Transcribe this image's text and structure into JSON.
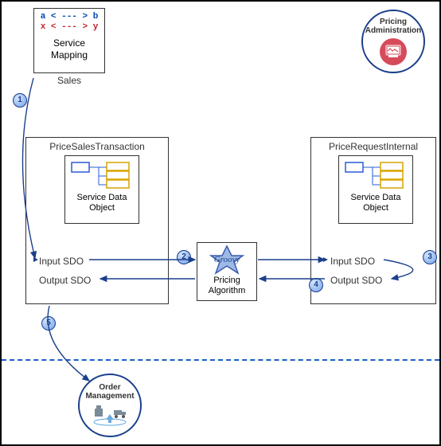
{
  "serviceMapping": {
    "code1": "a < --- > b",
    "code2": "x < --- > y",
    "label": "Service Mapping",
    "outer": "Sales"
  },
  "pst": {
    "title": "PriceSalesTransaction",
    "sdo": "Service Data Object",
    "input": "Input SDO",
    "output": "Output SDO"
  },
  "pri": {
    "title": "PriceRequestInternal",
    "sdo": "Service Data Object",
    "input": "Input SDO",
    "output": "Output SDO"
  },
  "algo": {
    "label": "Pricing Algorithm"
  },
  "pa": {
    "label": "Pricing Administration"
  },
  "om": {
    "label": "Order Management"
  },
  "steps": {
    "s1": "1",
    "s2": "2",
    "s3": "3",
    "s4": "4",
    "s5": "5"
  }
}
